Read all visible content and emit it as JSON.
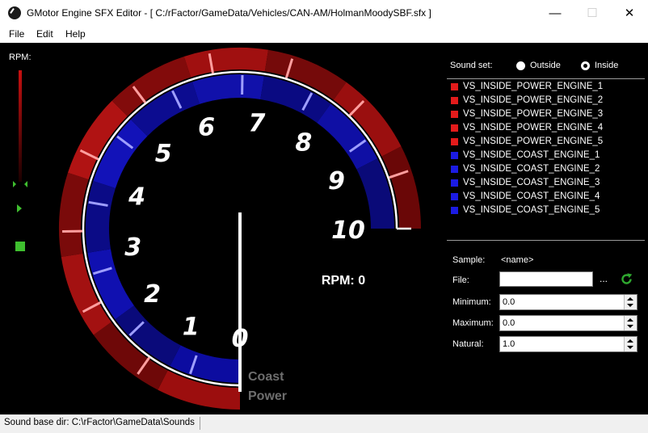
{
  "window": {
    "title": "GMotor Engine SFX Editor - [ C:/rFactor/GameData/Vehicles/CAN-AM/HolmanMoodySBF.sfx ]",
    "controls": {
      "minimize": "—",
      "maximize": "☐",
      "close": "✕"
    }
  },
  "menu": [
    "File",
    "Edit",
    "Help"
  ],
  "rpm_panel": {
    "label": "RPM:",
    "slider_level": 0.0
  },
  "gauge": {
    "ticks": [
      "0",
      "1",
      "2",
      "3",
      "4",
      "5",
      "6",
      "7",
      "8",
      "9",
      "10"
    ],
    "readout": "RPM: 0",
    "coast_label": "Coast",
    "power_label": "Power"
  },
  "sound_set": {
    "label": "Sound set:",
    "options": [
      {
        "label": "Outside",
        "checked": false
      },
      {
        "label": "Inside",
        "checked": true
      }
    ]
  },
  "samples": [
    {
      "name": "VS_INSIDE_POWER_ENGINE_1",
      "color": "#e31b1b"
    },
    {
      "name": "VS_INSIDE_POWER_ENGINE_2",
      "color": "#e31b1b"
    },
    {
      "name": "VS_INSIDE_POWER_ENGINE_3",
      "color": "#e31b1b"
    },
    {
      "name": "VS_INSIDE_POWER_ENGINE_4",
      "color": "#e31b1b"
    },
    {
      "name": "VS_INSIDE_POWER_ENGINE_5",
      "color": "#e31b1b"
    },
    {
      "name": "VS_INSIDE_COAST_ENGINE_1",
      "color": "#1b1be3"
    },
    {
      "name": "VS_INSIDE_COAST_ENGINE_2",
      "color": "#1b1be3"
    },
    {
      "name": "VS_INSIDE_COAST_ENGINE_3",
      "color": "#1b1be3"
    },
    {
      "name": "VS_INSIDE_COAST_ENGINE_4",
      "color": "#1b1be3"
    },
    {
      "name": "VS_INSIDE_COAST_ENGINE_5",
      "color": "#1b1be3"
    }
  ],
  "properties": {
    "sample_label": "Sample:",
    "sample_value": "<name>",
    "file_label": "File:",
    "file_value": "",
    "browse_label": "...",
    "minimum_label": "Minimum:",
    "minimum_value": "0.0",
    "maximum_label": "Maximum:",
    "maximum_value": "0.0",
    "natural_label": "Natural:",
    "natural_value": "1.0"
  },
  "status": {
    "text": "Sound base dir: C:\\rFactor\\GameData\\Sounds"
  },
  "colors": {
    "power": "#8a0b0b",
    "power_bright": "#cc1414",
    "coast": "#0a0a8c",
    "coast_bright": "#1c1cd0",
    "needle": "#ffffff",
    "tick_power": "#ff9e9e",
    "tick_coast": "#9e9eff",
    "refresh": "#2fa82f",
    "indicator": "#3fbf2f"
  }
}
